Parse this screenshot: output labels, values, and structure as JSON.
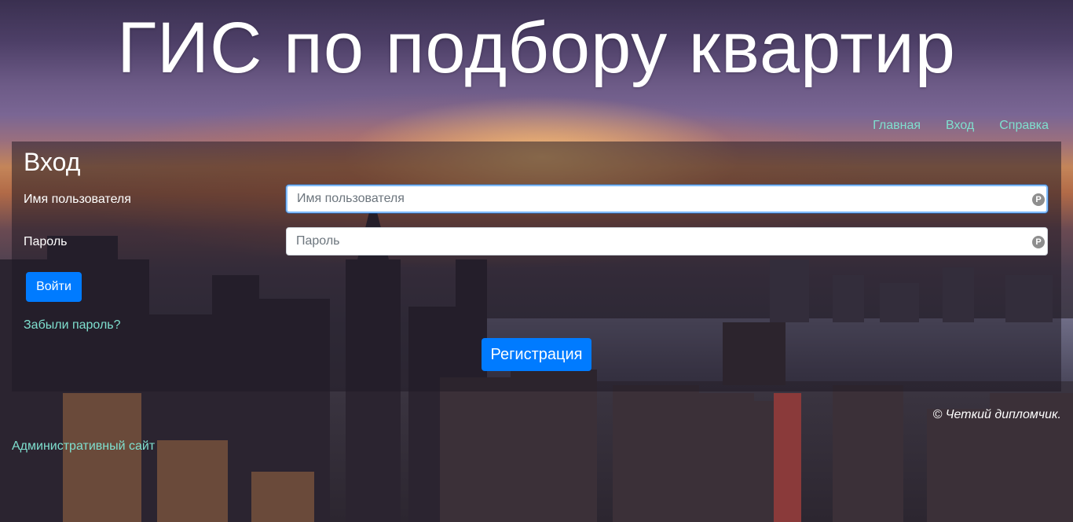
{
  "header": {
    "title": "ГИС по подбору квартир"
  },
  "nav": {
    "items": [
      {
        "label": "Главная"
      },
      {
        "label": "Вход"
      },
      {
        "label": "Справка"
      }
    ]
  },
  "login": {
    "heading": "Вход",
    "username": {
      "label": "Имя пользователя",
      "placeholder": "Имя пользователя",
      "value": ""
    },
    "password": {
      "label": "Пароль",
      "placeholder": "Пароль",
      "value": ""
    },
    "submit_label": "Войти",
    "forgot_label": "Забыли пароль?",
    "register_label": "Регистрация"
  },
  "footer": {
    "copyright": "© Четкий дипломчик.",
    "admin_link": "Административный сайт"
  },
  "icons": {
    "field_icon": "password-manager-icon",
    "field_icon_glyph": "P"
  },
  "colors": {
    "link": "#7fe0cf",
    "primary": "#007bff",
    "panel": "rgba(30,24,36,0.52)"
  }
}
